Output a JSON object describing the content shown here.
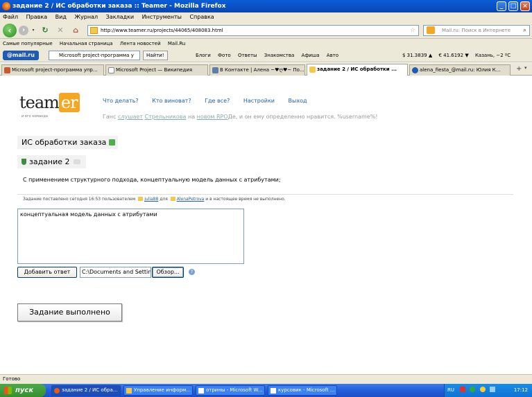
{
  "window": {
    "title": "задание 2 / ИС обработки заказа :: Teamer - Mozilla Firefox"
  },
  "menu": [
    "Файл",
    "Правка",
    "Вид",
    "Журнал",
    "Закладки",
    "Инструменты",
    "Справка"
  ],
  "nav": {
    "url": "http://www.teamer.ru/projects/44065/408083.html",
    "search_placeholder": "Mail.ru: Поиск в Интернете"
  },
  "bookmarks": [
    "Самые популярные",
    "Начальная страница",
    "Лента новостей",
    "Mail.Ru"
  ],
  "mailbar": {
    "logo": "@mail.ru",
    "search_value": "Microsoft project-программа у",
    "find_label": "Найти!",
    "items": [
      "Блоги",
      "Фото",
      "Ответы",
      "Знакомства",
      "Афиша",
      "Авто"
    ],
    "rates": [
      "$ 31.3839 ▲",
      "€ 41.6192 ▼",
      "Казань, −2 ºС"
    ]
  },
  "tabs": [
    {
      "label": "Microsoft project-программа упр..."
    },
    {
      "label": "Microsoft Project — Википедия"
    },
    {
      "label": "В Контакте | Алена ~♥ღ♥~ По..."
    },
    {
      "label": "задание 2 / ИС обработки ..."
    },
    {
      "label": "alena_fiesta_@mail.ru: Юлия К..."
    }
  ],
  "site": {
    "logo_main": "team",
    "logo_accent": "er",
    "logo_sub": "и его команда",
    "nav": [
      "Что делать?",
      "Кто виноват?",
      "Где все?",
      "Настройки",
      "Выход"
    ],
    "tagline": {
      "p1": "Ганс ",
      "link1": "слушает",
      "p2": " ",
      "link2": "Стрельникова",
      "p3": " на ",
      "link3": "новом RPO",
      "p4": "Де, и он ему определенно нравится. %username%!"
    }
  },
  "project": {
    "title": "ИС обработки заказа"
  },
  "task": {
    "title": "задание 2",
    "description": "С применением структурного подхода, концептуальную модель данных с атрибутами;",
    "meta": {
      "p1": "Задание поставлено сегодня 16:53 пользователем ",
      "user1": "julia88",
      "p2": " для ",
      "user2": "AlenaPetrova",
      "p3": " и в настоящее время не выполнено."
    }
  },
  "answer": {
    "text": "концептуальная модель данных с атрибутами",
    "add_label": "Добавить ответ",
    "file_path": "C:\\Documents and Settin",
    "browse_label": "Обзор...",
    "help": "?"
  },
  "done_label": "Задание выполнено",
  "status": "Готово",
  "taskbar": {
    "start": "пуск",
    "tasks": [
      "задание 2 / ИС обра...",
      "Управление информ...",
      "отрины - Microsoft W...",
      "курсовик - Microsoft ..."
    ],
    "lang": "RU",
    "clock": "17:12"
  }
}
